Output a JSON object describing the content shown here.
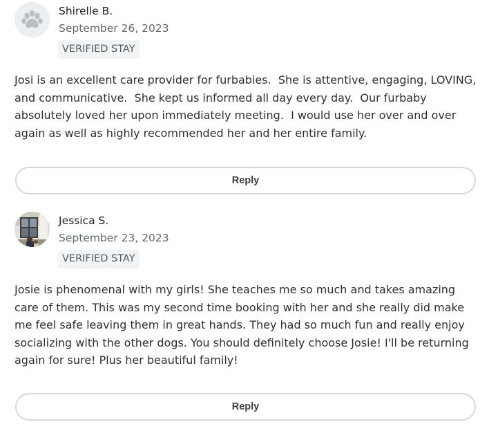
{
  "reviews": [
    {
      "reviewer_name": "Shirelle B.",
      "date": "September 26, 2023",
      "badge": "VERIFIED STAY",
      "avatar_icon": "paw-icon",
      "text": "Josi is an excellent care provider for furbabies.  She is attentive, engaging, LOVING, and communicative.  She kept us informed all day every day.  Our furbaby absolutely loved her upon immediately meeting.  I would use her over and over again as well as highly recommended her and her entire family.",
      "reply_label": "Reply"
    },
    {
      "reviewer_name": "Jessica S.",
      "date": "September 23, 2023",
      "badge": "VERIFIED STAY",
      "avatar_icon": "user-photo",
      "text": "Josie is phenomenal with my girls! She teaches me so much and takes amazing care of them. This was my second time booking with her and she really did make me feel safe leaving them in great hands. They had so much fun and really enjoy socializing with the other dogs. You should definitely choose Josie! I'll be returning again for sure! Plus her beautiful family!",
      "reply_label": "Reply"
    }
  ],
  "colors": {
    "avatar_bg": "#eceef0",
    "paw": "#b9bec3",
    "badge_bg": "#f2f3f4",
    "button_border": "#d6d9dc"
  }
}
